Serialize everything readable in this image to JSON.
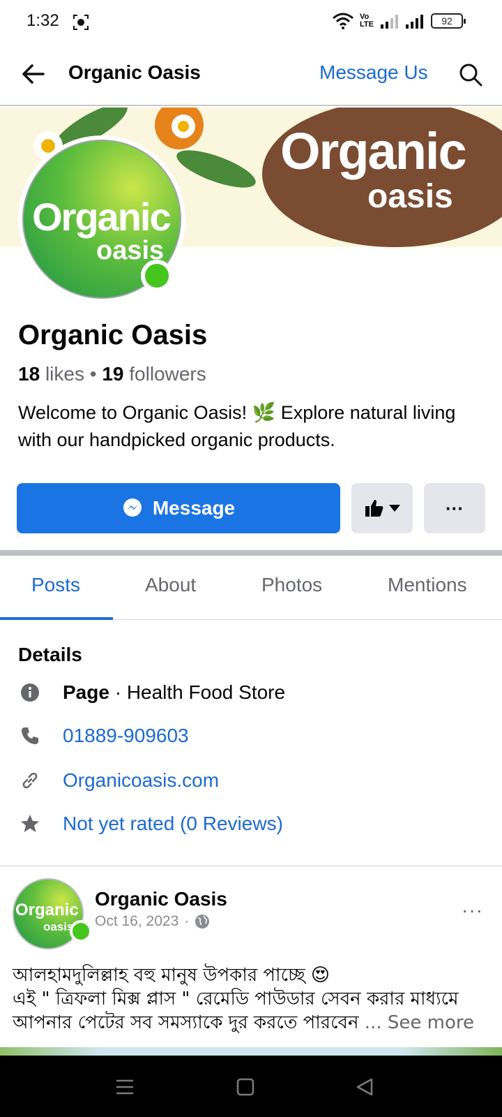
{
  "status_bar": {
    "time": "1:32",
    "network_label": "Vo LTE",
    "battery": "92"
  },
  "header": {
    "title": "Organic Oasis",
    "message_link": "Message Us"
  },
  "cover": {
    "logo_line1": "Organic",
    "logo_line2": "oasis"
  },
  "avatar": {
    "logo_line1": "Organic",
    "logo_line2": "oasis"
  },
  "page": {
    "name": "Organic Oasis",
    "likes_count": "18",
    "likes_label": "likes",
    "followers_count": "19",
    "followers_label": "followers",
    "bio": "Welcome to Organic Oasis! 🌿 Explore natural living with our handpicked organic products."
  },
  "actions": {
    "message_label": "Message",
    "more_label": "···"
  },
  "tabs": [
    {
      "label": "Posts"
    },
    {
      "label": "About"
    },
    {
      "label": "Photos"
    },
    {
      "label": "Mentions"
    }
  ],
  "details": {
    "title": "Details",
    "category_type": "Page",
    "category": " · Health Food Store",
    "phone": "01889-909603",
    "website": "Organicoasis.com",
    "rating": "Not yet rated (0 Reviews)"
  },
  "post": {
    "author": "Organic Oasis",
    "date": "Oct 16, 2023",
    "text_line1": "আলহামদুলিল্লাহ বহু মানুষ উপকার পাচ্ছে 😍",
    "text_line2": "এই \" ত্রিফলা মিক্স প্লাস \" রেমেডি পাউডার সেবন করার মাধ্যমে",
    "text_line3": "আপনার পেটের সব সমস্যাকে দুর করতে পারবেন",
    "see_more": " ... See more",
    "options_label": "···"
  },
  "colors": {
    "accent": "#1b74e4",
    "link": "#1b6ad2",
    "online": "#46c51f"
  }
}
